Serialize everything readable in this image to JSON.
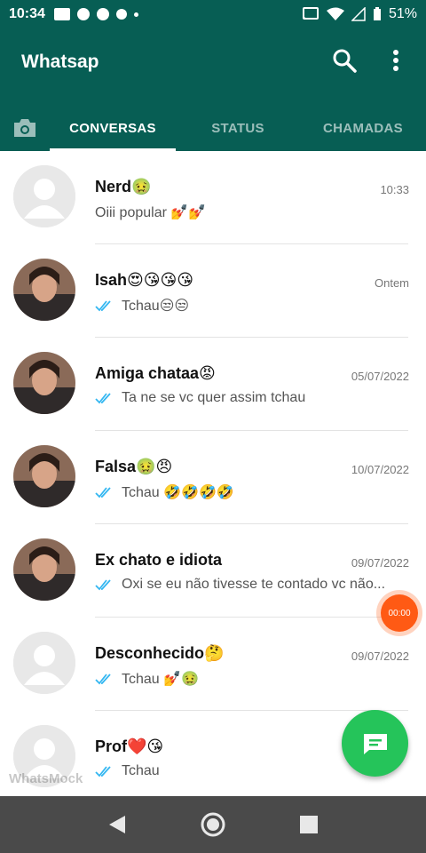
{
  "status_bar": {
    "time": "10:34",
    "battery": "51%"
  },
  "app": {
    "title": "Whatsap"
  },
  "tabs": [
    {
      "label": "CONVERSAS",
      "active": true
    },
    {
      "label": "STATUS",
      "active": false
    },
    {
      "label": "CHAMADAS",
      "active": false
    }
  ],
  "chats": [
    {
      "name": "Nerd🤢",
      "time": "10:33",
      "message": "Oiii popular 💅💅",
      "read": false,
      "avatar": "default"
    },
    {
      "name": "Isah😍😘😘😘",
      "time": "Ontem",
      "message": "Tchau😒😒",
      "read": true,
      "avatar": "photo"
    },
    {
      "name": "Amiga chataa😡",
      "time": "05/07/2022",
      "message": "Ta ne se vc quer assim tchau",
      "read": true,
      "avatar": "photo"
    },
    {
      "name": "Falsa🤢😠",
      "time": "10/07/2022",
      "message": "Tchau 🤣🤣🤣🤣",
      "read": true,
      "avatar": "photo"
    },
    {
      "name": "Ex chato e idiota",
      "time": "09/07/2022",
      "message": "Oxi se eu não tivesse te contado vc não...",
      "read": true,
      "avatar": "photo"
    },
    {
      "name": "Desconhecido🤔",
      "time": "09/07/2022",
      "message": "Tchau 💅🤢",
      "read": true,
      "avatar": "default"
    },
    {
      "name": "Prof❤️😘",
      "time": "",
      "message": "Tchau",
      "read": true,
      "avatar": "default"
    }
  ],
  "floating_timer": "00:00",
  "watermark": "WhatsMock",
  "colors": {
    "header": "#075e54",
    "accent": "#25c45a",
    "tick": "#34b7f1"
  }
}
